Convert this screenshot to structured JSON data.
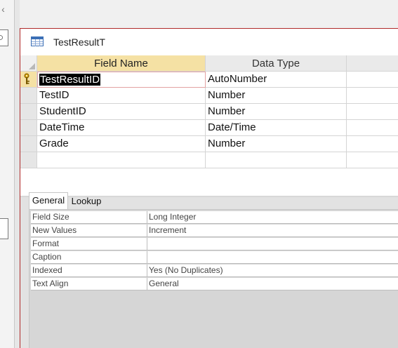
{
  "document": {
    "title": "TestResultT"
  },
  "grid": {
    "headers": {
      "field_name": "Field Name",
      "data_type": "Data Type",
      "description": ""
    },
    "rows": [
      {
        "field_name": "TestResultID",
        "data_type": "AutoNumber",
        "is_key": true
      },
      {
        "field_name": "TestID",
        "data_type": "Number"
      },
      {
        "field_name": "StudentID",
        "data_type": "Number"
      },
      {
        "field_name": "DateTime",
        "data_type": "Date/Time"
      },
      {
        "field_name": "Grade",
        "data_type": "Number"
      },
      {
        "field_name": "",
        "data_type": ""
      }
    ]
  },
  "properties": {
    "tabs": {
      "general": "General",
      "lookup": "Lookup"
    },
    "rows": [
      {
        "label": "Field Size",
        "value": "Long Integer"
      },
      {
        "label": "New Values",
        "value": "Increment"
      },
      {
        "label": "Format",
        "value": ""
      },
      {
        "label": "Caption",
        "value": ""
      },
      {
        "label": "Indexed",
        "value": "Yes (No Duplicates)"
      },
      {
        "label": "Text Align",
        "value": "General"
      }
    ]
  },
  "icons": {
    "nav_chevron": "chevron-left-icon",
    "nav_search": "search-icon",
    "table": "table-icon",
    "primary_key": "key-icon"
  },
  "colors": {
    "selected_header": "#f5e1a4",
    "window_border": "#b02a2a",
    "table_icon_blue": "#3b6fb6"
  }
}
